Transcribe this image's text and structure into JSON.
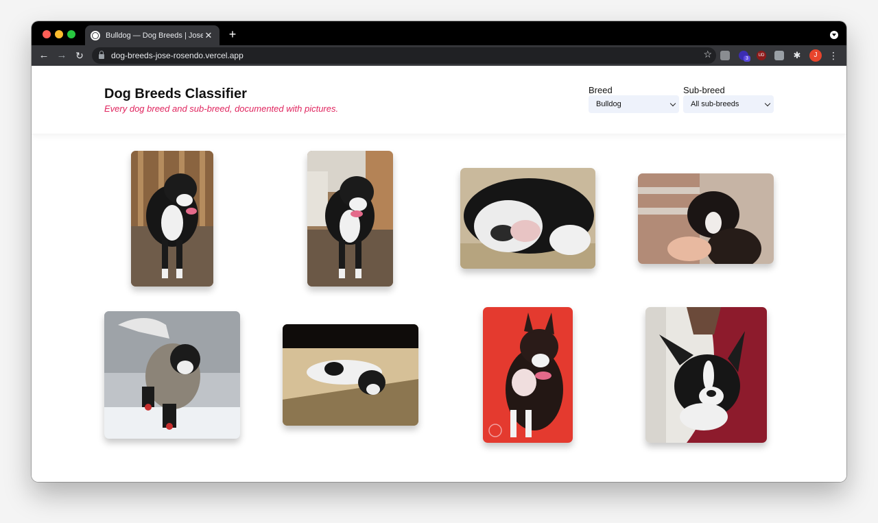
{
  "browser": {
    "tab_title": "Bulldog — Dog Breeds | Jose R",
    "url": "dog-breeds-jose-rosendo.vercel.app",
    "extension_badge": "3",
    "ext_ud_label": "UD",
    "avatar_initial": "J",
    "icons": {
      "back": "←",
      "forward": "→",
      "reload": "↻",
      "star": "☆",
      "close": "✕",
      "new_tab": "+",
      "menu": "⋮",
      "puzzle": "✱"
    }
  },
  "header": {
    "title": "Dog Breeds Classifier",
    "subtitle": "Every dog breed and sub-breed, documented with pictures.",
    "breed_label": "Breed",
    "breed_value": "Bulldog",
    "subbreed_label": "Sub-breed",
    "subbreed_value": "All sub-breeds"
  },
  "colors": {
    "accent": "#e0245e",
    "select_bg": "#eef2fb"
  },
  "gallery": [
    {
      "name": "dog-photo-1",
      "alt": "Boston terrier standing on deck"
    },
    {
      "name": "dog-photo-2",
      "alt": "Boston terrier on deck near railing"
    },
    {
      "name": "dog-photo-3",
      "alt": "Boston terrier sleeping close-up"
    },
    {
      "name": "dog-photo-4",
      "alt": "Boston terrier puppy held by hand"
    },
    {
      "name": "dog-photo-5",
      "alt": "Boston terrier running in snow with boots"
    },
    {
      "name": "dog-photo-6",
      "alt": "Boston terrier lying on blanket in sun"
    },
    {
      "name": "dog-photo-7",
      "alt": "Boston terrier on red background"
    },
    {
      "name": "dog-photo-8",
      "alt": "Boston terrier held in arms"
    }
  ]
}
